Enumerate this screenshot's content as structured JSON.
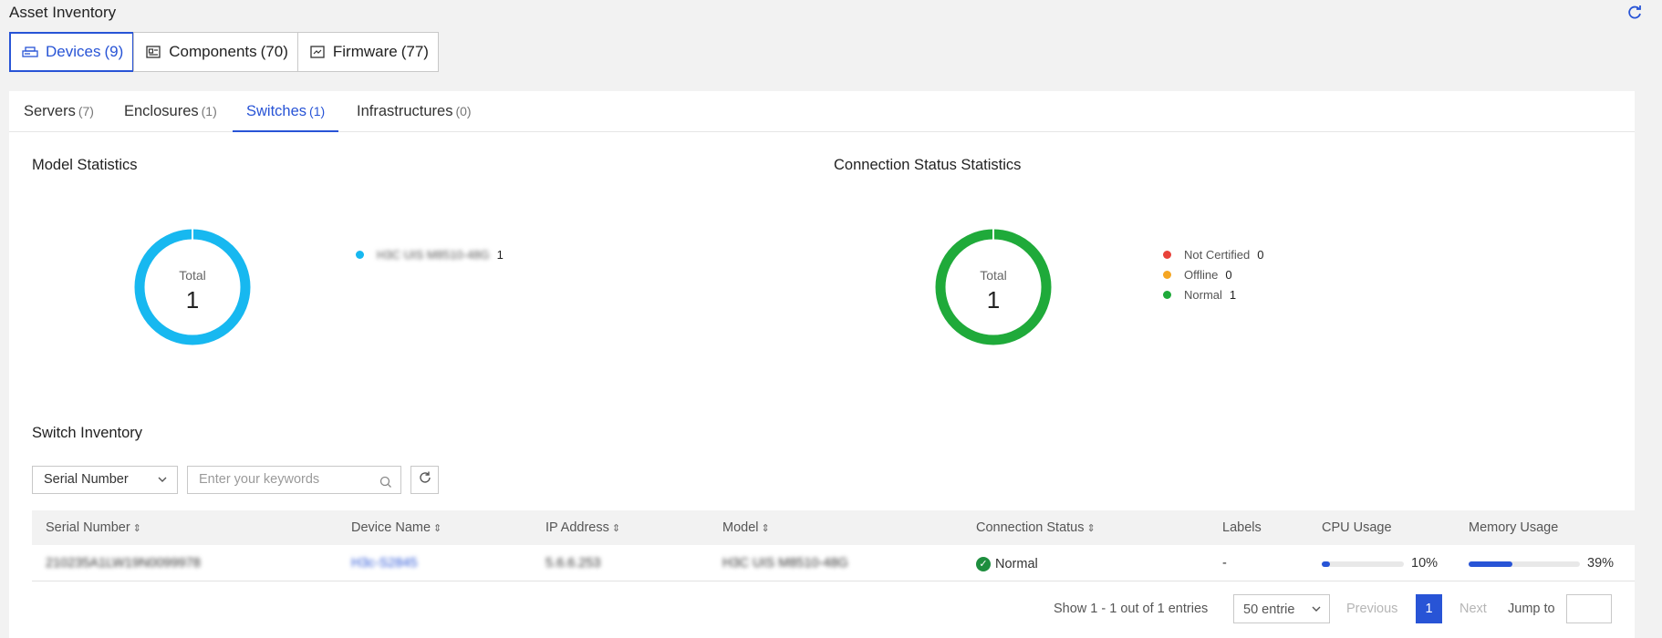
{
  "page": {
    "title": "Asset Inventory"
  },
  "top_tabs": [
    {
      "label": "Devices",
      "count": "(9)",
      "icon": "devices-icon"
    },
    {
      "label": "Components",
      "count": "(70)",
      "icon": "components-icon"
    },
    {
      "label": "Firmware",
      "count": "(77)",
      "icon": "firmware-icon"
    }
  ],
  "sub_tabs": [
    {
      "label": "Servers",
      "count": "(7)"
    },
    {
      "label": "Enclosures",
      "count": "(1)"
    },
    {
      "label": "Switches",
      "count": "(1)"
    },
    {
      "label": "Infrastructures",
      "count": "(0)"
    }
  ],
  "model_stats": {
    "title": "Model Statistics",
    "total_label": "Total",
    "total_value": "1",
    "legend": [
      {
        "label": "H3C UIS M8510-48G",
        "value": "1",
        "color": "#17b8f0"
      }
    ]
  },
  "connection_stats": {
    "title": "Connection Status Statistics",
    "total_label": "Total",
    "total_value": "1",
    "legend": [
      {
        "label": "Not Certified",
        "value": "0",
        "color": "#e8423a"
      },
      {
        "label": "Offline",
        "value": "0",
        "color": "#f5a623"
      },
      {
        "label": "Normal",
        "value": "1",
        "color": "#1faa3a"
      }
    ]
  },
  "inventory": {
    "title": "Switch Inventory",
    "filter_field": "Serial Number",
    "search_placeholder": "Enter your keywords",
    "columns": [
      "Serial Number",
      "Device Name",
      "IP Address",
      "Model",
      "Connection Status",
      "Labels",
      "CPU Usage",
      "Memory Usage"
    ],
    "rows": [
      {
        "serial": "210235A1LW19N0099978",
        "device_name": "H3c-S2845",
        "ip": "5.6.6.253",
        "model": "H3C UIS M8510-48G",
        "status": "Normal",
        "labels": "-",
        "cpu": "10%",
        "cpu_pct": 10,
        "memory": "39%",
        "memory_pct": 39
      }
    ]
  },
  "pagination": {
    "summary": "Show 1 - 1 out of 1 entries",
    "page_size": "50 entrie",
    "previous": "Previous",
    "current": "1",
    "next": "Next",
    "jump_to": "Jump to"
  },
  "colors": {
    "accent": "#2854d6",
    "model_ring": "#17b8f0",
    "normal_ring": "#1faa3a"
  }
}
